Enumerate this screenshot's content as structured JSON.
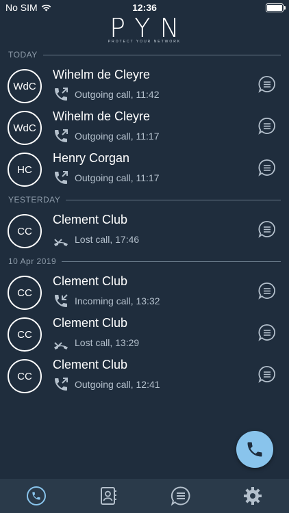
{
  "status_bar": {
    "carrier": "No SIM",
    "time": "12:36"
  },
  "header": {
    "logo": "PYN",
    "tagline": "PROTECT YOUR NETWORK"
  },
  "sections": [
    {
      "label": "TODAY",
      "items": [
        {
          "initials": "WdC",
          "name": "Wihelm de Cleyre",
          "detail": "Outgoing call, 11:42",
          "type": "outgoing"
        },
        {
          "initials": "WdC",
          "name": "Wihelm de Cleyre",
          "detail": "Outgoing call, 11:17",
          "type": "outgoing"
        },
        {
          "initials": "HC",
          "name": "Henry Corgan",
          "detail": "Outgoing call, 11:17",
          "type": "outgoing"
        }
      ]
    },
    {
      "label": "YESTERDAY",
      "items": [
        {
          "initials": "CC",
          "name": "Clement Club",
          "detail": "Lost call, 17:46",
          "type": "lost"
        }
      ]
    },
    {
      "label": "10 Apr 2019",
      "items": [
        {
          "initials": "CC",
          "name": "Clement Club",
          "detail": "Incoming call, 13:32",
          "type": "incoming"
        },
        {
          "initials": "CC",
          "name": "Clement Club",
          "detail": "Lost call, 13:29",
          "type": "lost"
        },
        {
          "initials": "CC",
          "name": "Clement Club",
          "detail": "Outgoing call, 12:41",
          "type": "outgoing"
        }
      ]
    }
  ],
  "tabs": [
    {
      "icon": "phone-icon",
      "active": true
    },
    {
      "icon": "contacts-icon",
      "active": false
    },
    {
      "icon": "message-icon",
      "active": false
    },
    {
      "icon": "gear-icon",
      "active": false
    }
  ],
  "colors": {
    "background": "#1f2d3d",
    "tab_bar": "#2a3a4a",
    "accent": "#89c4ec",
    "muted_icon": "#b4c0cc"
  }
}
